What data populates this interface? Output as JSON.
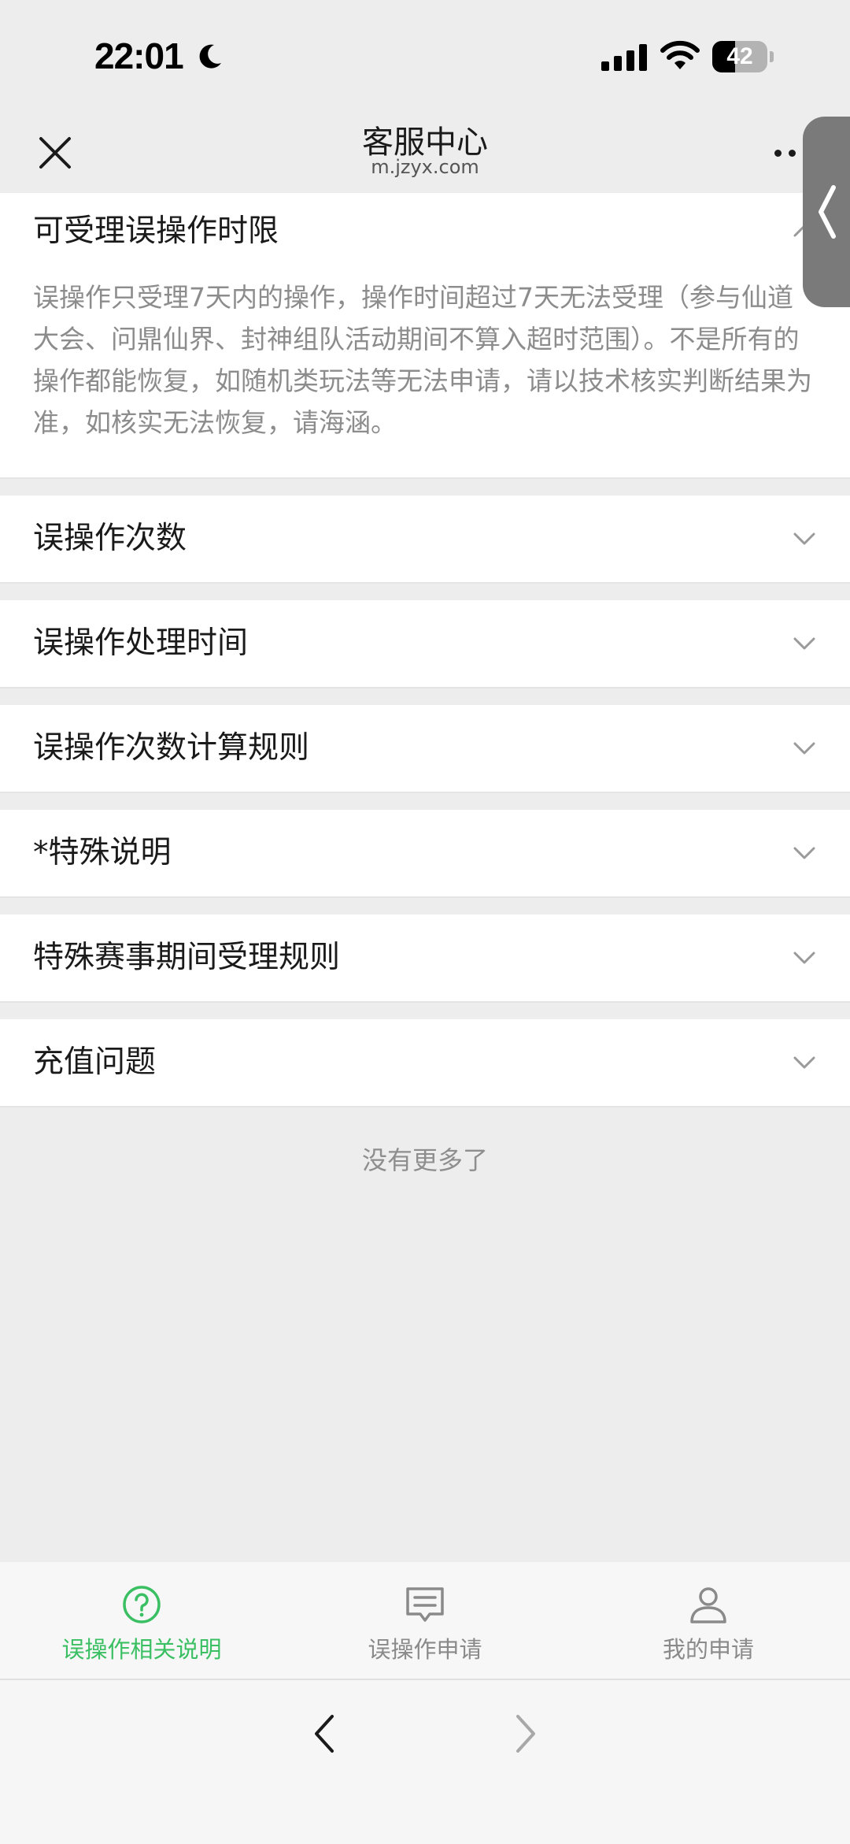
{
  "status_bar": {
    "time": "22:01",
    "battery_level": "42",
    "battery_fraction": 0.42
  },
  "nav": {
    "title": "客服中心",
    "subtitle": "m.jzyx.com"
  },
  "sections": [
    {
      "title": "可受理误操作时限",
      "expanded": true,
      "body": "误操作只受理7天内的操作，操作时间超过7天无法受理（参与仙道大会、问鼎仙界、封神组队活动期间不算入超时范围）。不是所有的操作都能恢复，如随机类玩法等无法申请，请以技术核实判断结果为准，如核实无法恢复，请海涵。"
    },
    {
      "title": "误操作次数",
      "expanded": false
    },
    {
      "title": "误操作处理时间",
      "expanded": false
    },
    {
      "title": "误操作次数计算规则",
      "expanded": false
    },
    {
      "title": "*特殊说明",
      "expanded": false
    },
    {
      "title": "特殊赛事期间受理规则",
      "expanded": false
    },
    {
      "title": "充值问题",
      "expanded": false
    }
  ],
  "list_footer": "没有更多了",
  "tabs": [
    {
      "label": "误操作相关说明",
      "icon": "question-circle-icon",
      "active": true
    },
    {
      "label": "误操作申请",
      "icon": "message-icon",
      "active": false
    },
    {
      "label": "我的申请",
      "icon": "person-icon",
      "active": false
    }
  ],
  "colors": {
    "accent": "#3bbf63",
    "inactive": "#8a8a8a",
    "background": "#ededed"
  }
}
